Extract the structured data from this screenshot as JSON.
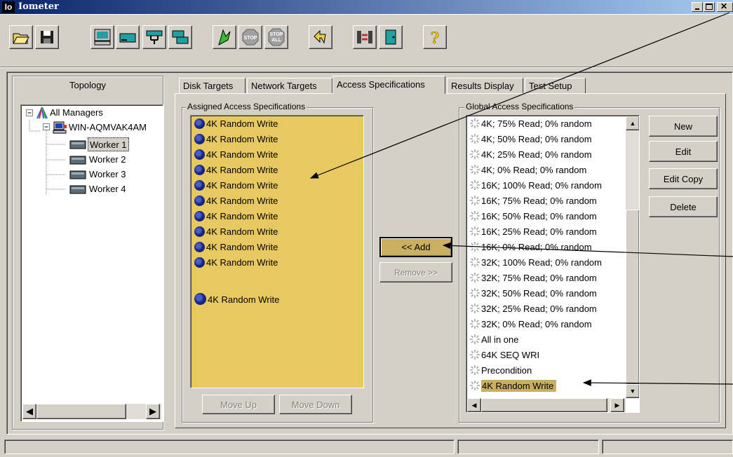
{
  "window": {
    "title": "Iometer",
    "icon_text": "Io"
  },
  "toolbar": {
    "buttons": [
      {
        "name": "open-config-icon"
      },
      {
        "name": "save-config-icon"
      },
      {
        "name": "start-display-icon"
      },
      {
        "name": "new-disk-worker-icon"
      },
      {
        "name": "new-network-worker-icon"
      },
      {
        "name": "duplicate-worker-icon"
      },
      {
        "name": "start-tests-icon"
      },
      {
        "name": "stop-icon",
        "text": "STOP"
      },
      {
        "name": "stop-all-icon",
        "text1": "STOP",
        "text2": "ALL"
      },
      {
        "name": "reset-workers-icon"
      },
      {
        "name": "disconnect-icon"
      },
      {
        "name": "exit-icon"
      },
      {
        "name": "help-icon",
        "text": "?"
      }
    ]
  },
  "topology": {
    "title": "Topology",
    "root": "All Managers",
    "manager": "WIN-AQMVAK4AM",
    "workers": [
      "Worker 1",
      "Worker 2",
      "Worker 3",
      "Worker 4"
    ],
    "selected_worker": "Worker 1"
  },
  "tabs": [
    "Disk Targets",
    "Network Targets",
    "Access Specifications",
    "Results Display",
    "Test Setup"
  ],
  "active_tab": "Access Specifications",
  "assigned": {
    "label": "Assigned Access Specifications",
    "items": [
      "4K Random Write",
      "4K Random Write",
      "4K Random Write",
      "4K Random Write",
      "4K Random Write",
      "4K Random Write",
      "4K Random Write",
      "4K Random Write",
      "4K Random Write",
      "4K Random Write"
    ],
    "extra_item": "4K Random Write",
    "move_up": "Move Up",
    "move_down": "Move Down"
  },
  "middle": {
    "add": "<< Add",
    "remove": "Remove >>"
  },
  "global": {
    "label": "Global Access Specifications",
    "items": [
      "4K; 75% Read; 0% random",
      "4K; 50% Read; 0% random",
      "4K; 25% Read; 0% random",
      "4K; 0% Read; 0% random",
      "16K; 100% Read; 0% random",
      "16K; 75% Read; 0% random",
      "16K; 50% Read; 0% random",
      "16K; 25% Read; 0% random",
      "16K; 0% Read; 0% random",
      "32K; 100% Read; 0% random",
      "32K; 75% Read; 0% random",
      "32K; 50% Read; 0% random",
      "32K; 25% Read; 0% random",
      "32K; 0% Read; 0% random",
      "All in one",
      "64K SEQ WRI",
      "Precondition",
      "4K Random Write"
    ],
    "selected_item": "4K Random Write"
  },
  "spec_buttons": {
    "new": "New",
    "edit": "Edit",
    "edit_copy": "Edit Copy",
    "delete": "Delete"
  },
  "colors": {
    "highlight": "#c8b060",
    "list_yellow": "#e8c860",
    "titlebar": "#0a246a"
  }
}
